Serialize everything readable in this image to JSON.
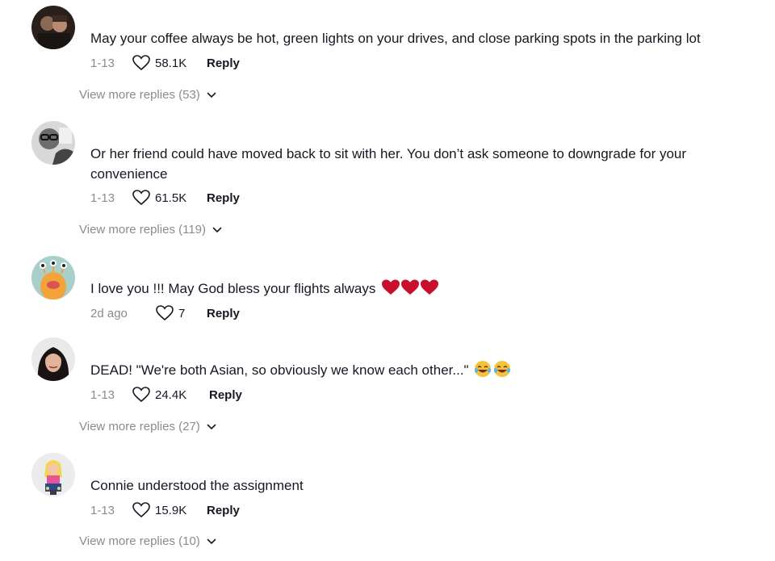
{
  "comments": [
    {
      "text": "May your coffee always be hot, green lights on your drives, and close parking spots in the parking lot",
      "date": "1-13",
      "likes": "58.1K",
      "reply_label": "Reply",
      "more_label": "View more replies (53)",
      "avatar_icon": "couple-photo-avatar"
    },
    {
      "text": "Or her friend could have moved back to sit with her. You don’t ask someone to downgrade for your convenience",
      "date": "1-13",
      "likes": "61.5K",
      "reply_label": "Reply",
      "more_label": "View more replies (119)",
      "avatar_icon": "glasses-man-avatar"
    },
    {
      "text": "I love you !!! May God bless your flights always",
      "emoji": "heart-emoji x3",
      "date": "2d ago",
      "likes": "7",
      "reply_label": "Reply",
      "avatar_icon": "cartoon-monster-avatar"
    },
    {
      "text": "DEAD! \"We're both Asian, so obviously we know each other...\"",
      "emoji": "tears-of-joy-emoji x2",
      "date": "1-13",
      "likes": "24.4K",
      "reply_label": "Reply",
      "more_label": "View more replies (27)",
      "avatar_icon": "woman-dark-hair-avatar"
    },
    {
      "text": "Connie understood the assignment",
      "date": "1-13",
      "likes": "15.9K",
      "reply_label": "Reply",
      "more_label": "View more replies (10)",
      "avatar_icon": "cartoon-girl-avatar"
    }
  ],
  "colors": {
    "text": "#161823",
    "muted": "#8a8b91",
    "heart_emoji": "#c8102e"
  }
}
